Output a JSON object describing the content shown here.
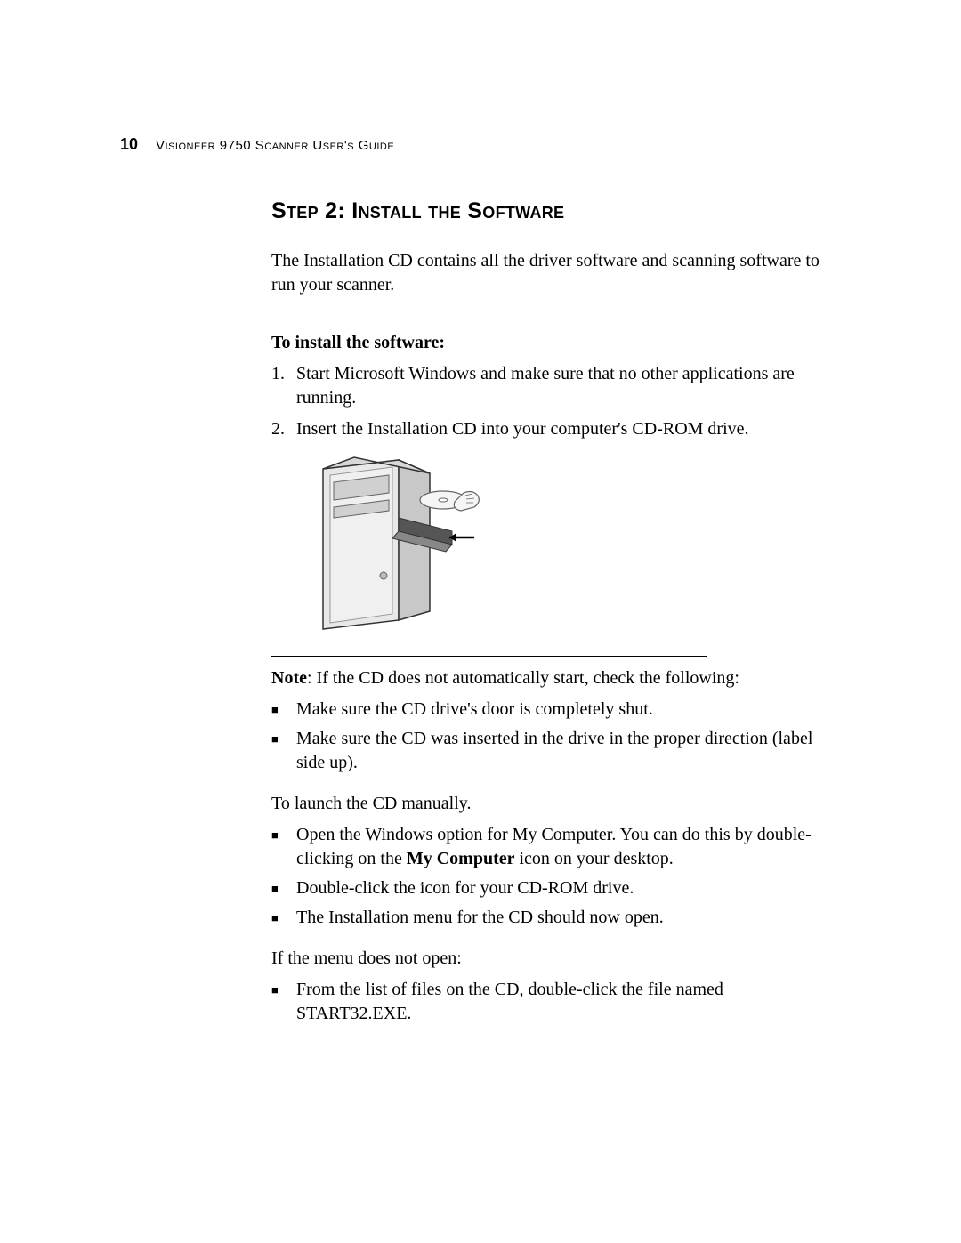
{
  "header": {
    "page_number": "10",
    "title": "Visioneer 9750 Scanner User's Guide"
  },
  "section": {
    "heading": "Step 2: Install the Software",
    "intro": "The Installation CD contains all the driver software and scanning software to run your scanner."
  },
  "install": {
    "subheading": "To install the software:",
    "steps": [
      {
        "num": "1.",
        "text": "Start Microsoft Windows and make sure that no other applications are running."
      },
      {
        "num": "2.",
        "text": "Insert the Installation CD into your computer's CD-ROM drive."
      }
    ]
  },
  "note": {
    "prefix": "Note",
    "text": ":  If the CD does not automatically start, check the following:",
    "bullets": [
      "Make sure the CD drive's door is completely shut.",
      "Make sure the CD was inserted in the drive in the proper direction (label side up)."
    ]
  },
  "launch": {
    "intro": "To launch the CD manually.",
    "bullets": [
      {
        "pre": "Open the Windows option for My Computer. You can do this by double-clicking on the ",
        "bold": "My Computer",
        "post": " icon on your desktop."
      },
      {
        "pre": "Double-click the icon for your CD-ROM drive.",
        "bold": "",
        "post": ""
      },
      {
        "pre": "The Installation menu for the CD should now open.",
        "bold": "",
        "post": ""
      }
    ]
  },
  "noopen": {
    "intro": "If the menu does not open:",
    "bullets": [
      "From the list of files on the CD, double-click the file named START32.EXE."
    ]
  }
}
